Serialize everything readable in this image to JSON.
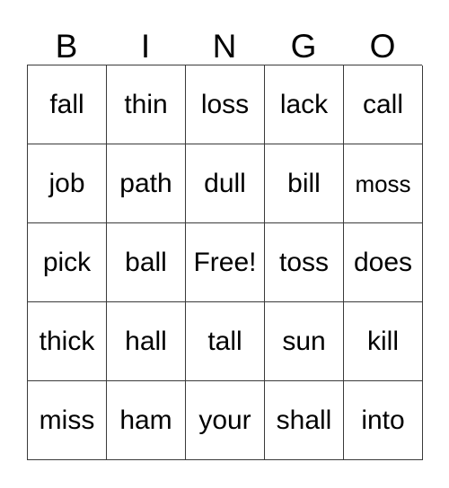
{
  "card": {
    "title_letters": [
      "B",
      "I",
      "N",
      "G",
      "O"
    ],
    "columns": 5,
    "rows": 5,
    "free_space": {
      "row": 2,
      "col": 2,
      "label": "Free!"
    },
    "colors": {
      "background": "#ffffff",
      "grid_line": "#3a3a3a",
      "text": "#000000"
    },
    "grid": [
      [
        {
          "label": "fall",
          "fit": "normal"
        },
        {
          "label": "thin",
          "fit": "normal"
        },
        {
          "label": "loss",
          "fit": "normal"
        },
        {
          "label": "lack",
          "fit": "normal"
        },
        {
          "label": "call",
          "fit": "normal"
        }
      ],
      [
        {
          "label": "job",
          "fit": "normal"
        },
        {
          "label": "path",
          "fit": "normal"
        },
        {
          "label": "dull",
          "fit": "normal"
        },
        {
          "label": "bill",
          "fit": "normal"
        },
        {
          "label": "moss",
          "fit": "small"
        }
      ],
      [
        {
          "label": "pick",
          "fit": "normal"
        },
        {
          "label": "ball",
          "fit": "normal"
        },
        {
          "label": "Free!",
          "fit": "normal"
        },
        {
          "label": "toss",
          "fit": "normal"
        },
        {
          "label": "does",
          "fit": "normal"
        }
      ],
      [
        {
          "label": "thick",
          "fit": "normal"
        },
        {
          "label": "hall",
          "fit": "normal"
        },
        {
          "label": "tall",
          "fit": "normal"
        },
        {
          "label": "sun",
          "fit": "normal"
        },
        {
          "label": "kill",
          "fit": "normal"
        }
      ],
      [
        {
          "label": "miss",
          "fit": "normal"
        },
        {
          "label": "ham",
          "fit": "normal"
        },
        {
          "label": "your",
          "fit": "normal"
        },
        {
          "label": "shall",
          "fit": "normal"
        },
        {
          "label": "into",
          "fit": "normal"
        }
      ]
    ]
  }
}
